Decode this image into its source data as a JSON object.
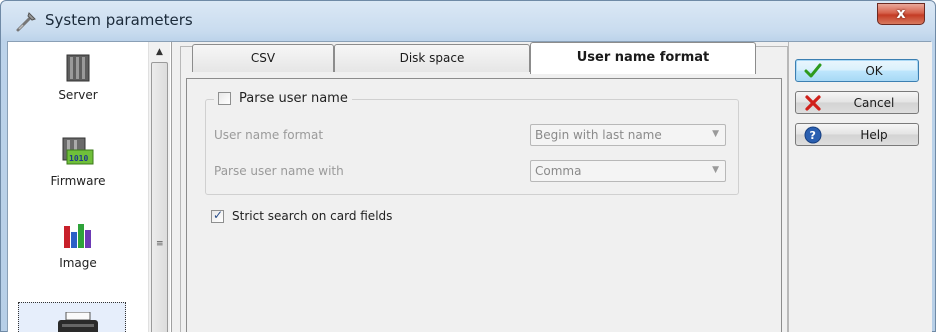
{
  "window": {
    "title": "System parameters",
    "close_glyph": "x"
  },
  "nav": {
    "items": [
      {
        "label": "Server",
        "icon": "server-icon"
      },
      {
        "label": "Firmware",
        "icon": "firmware-icon"
      },
      {
        "label": "Image",
        "icon": "image-icon"
      },
      {
        "label": "",
        "icon": "printer-icon",
        "selected": true
      }
    ]
  },
  "tabs": [
    {
      "label": "CSV"
    },
    {
      "label": "Disk space"
    },
    {
      "label": "User name format",
      "active": true
    }
  ],
  "parse_group": {
    "checkbox_label": "Parse user name",
    "checked": false,
    "rows": [
      {
        "label": "User name format",
        "value": "Begin with last name"
      },
      {
        "label": "Parse user name with",
        "value": "Comma"
      }
    ]
  },
  "strict_search": {
    "label": "Strict search on card fields",
    "checked": true
  },
  "buttons": {
    "ok": "OK",
    "cancel": "Cancel",
    "help": "Help"
  },
  "colors": {
    "ok_check": "#2e9a1e",
    "cancel_x": "#d0201a",
    "help_blue": "#2a5fb0"
  }
}
